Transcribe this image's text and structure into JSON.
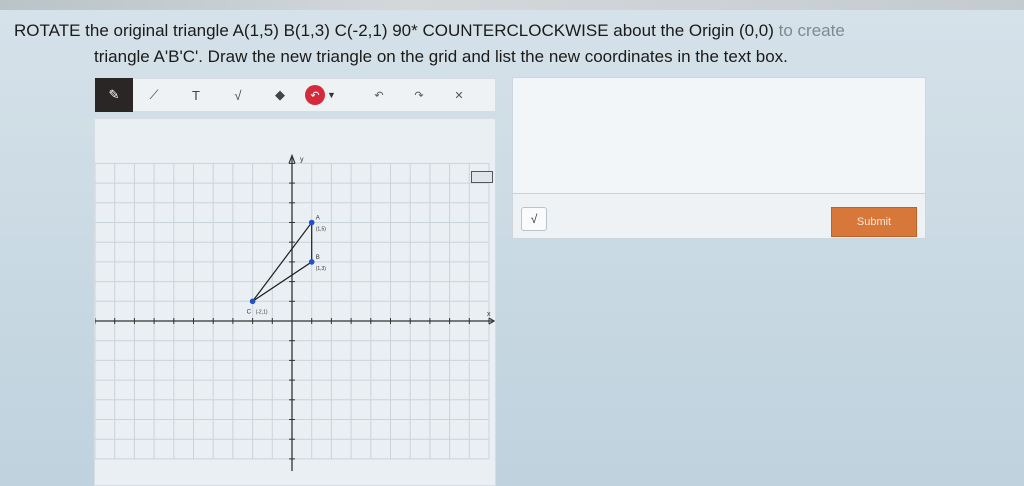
{
  "question": {
    "line1": "ROTATE the original triangle A(1,5) B(1,3) C(-2,1) 90* COUNTERCLOCKWISE about the Origin (0,0)",
    "line1_end": "to create",
    "line2": "triangle A'B'C'. Draw the new triangle on the grid and list the new coordinates in the text box."
  },
  "toolbar": {
    "pencil": "✎",
    "line": "⟋",
    "text": "T",
    "sqrt": "√",
    "eraser": "◆",
    "color": "↶",
    "caret": "▼",
    "undo": "↶",
    "redo": "↷",
    "clear": "✕"
  },
  "graph": {
    "y_axis_label": "y",
    "x_axis_label": "x",
    "point_labels": {
      "A": "A",
      "A_coords": "(1,5)",
      "B": "B",
      "B_coords": "(1,3)",
      "C": "C",
      "C_coords": "(-2,1)"
    }
  },
  "answer": {
    "value": "",
    "sqrt_label": "√",
    "submit_label": "Submit"
  }
}
